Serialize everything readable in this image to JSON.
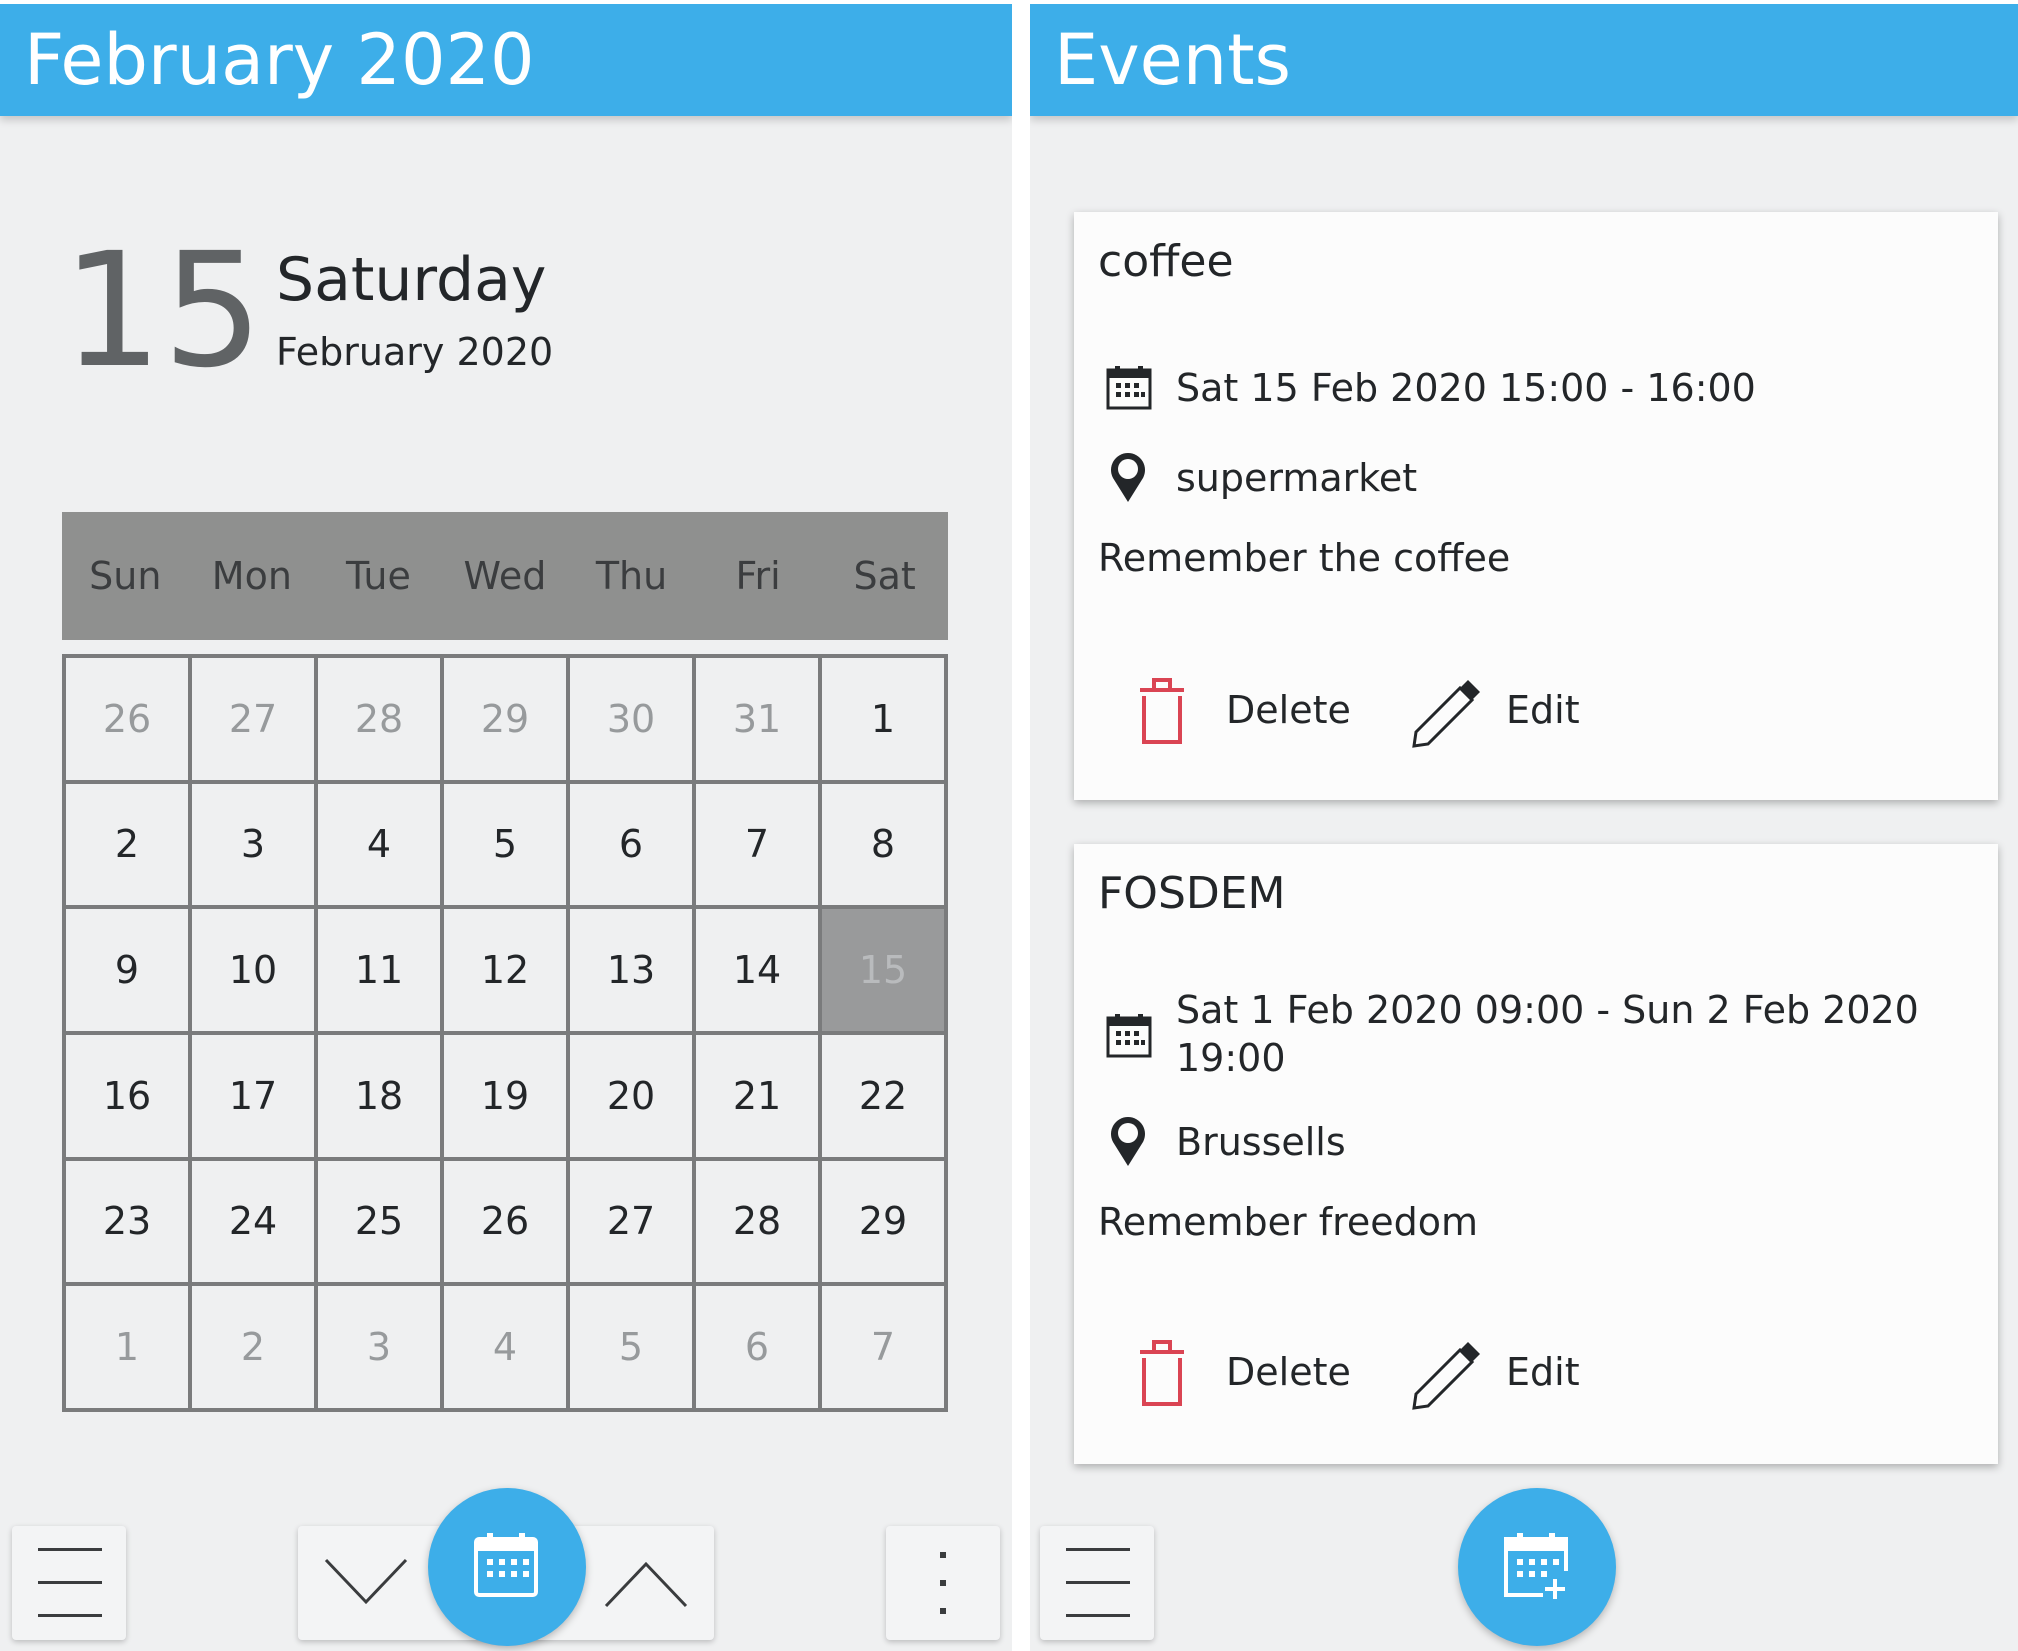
{
  "calendar_panel": {
    "title": "February 2020",
    "day_number": "15",
    "day_name": "Saturday",
    "day_month": "February 2020",
    "weekdays": [
      "Sun",
      "Mon",
      "Tue",
      "Wed",
      "Thu",
      "Fri",
      "Sat"
    ],
    "days": [
      {
        "label": "26",
        "in_month": false
      },
      {
        "label": "27",
        "in_month": false
      },
      {
        "label": "28",
        "in_month": false
      },
      {
        "label": "29",
        "in_month": false
      },
      {
        "label": "30",
        "in_month": false
      },
      {
        "label": "31",
        "in_month": false
      },
      {
        "label": "1",
        "in_month": true
      },
      {
        "label": "2",
        "in_month": true
      },
      {
        "label": "3",
        "in_month": true
      },
      {
        "label": "4",
        "in_month": true
      },
      {
        "label": "5",
        "in_month": true
      },
      {
        "label": "6",
        "in_month": true
      },
      {
        "label": "7",
        "in_month": true
      },
      {
        "label": "8",
        "in_month": true
      },
      {
        "label": "9",
        "in_month": true
      },
      {
        "label": "10",
        "in_month": true
      },
      {
        "label": "11",
        "in_month": true
      },
      {
        "label": "12",
        "in_month": true
      },
      {
        "label": "13",
        "in_month": true
      },
      {
        "label": "14",
        "in_month": true
      },
      {
        "label": "15",
        "in_month": true,
        "selected": true
      },
      {
        "label": "16",
        "in_month": true
      },
      {
        "label": "17",
        "in_month": true
      },
      {
        "label": "18",
        "in_month": true
      },
      {
        "label": "19",
        "in_month": true
      },
      {
        "label": "20",
        "in_month": true
      },
      {
        "label": "21",
        "in_month": true
      },
      {
        "label": "22",
        "in_month": true
      },
      {
        "label": "23",
        "in_month": true
      },
      {
        "label": "24",
        "in_month": true
      },
      {
        "label": "25",
        "in_month": true
      },
      {
        "label": "26",
        "in_month": true
      },
      {
        "label": "27",
        "in_month": true
      },
      {
        "label": "28",
        "in_month": true
      },
      {
        "label": "29",
        "in_month": true
      },
      {
        "label": "1",
        "in_month": false
      },
      {
        "label": "2",
        "in_month": false
      },
      {
        "label": "3",
        "in_month": false
      },
      {
        "label": "4",
        "in_month": false
      },
      {
        "label": "5",
        "in_month": false
      },
      {
        "label": "6",
        "in_month": false
      },
      {
        "label": "7",
        "in_month": false
      }
    ],
    "toolbar": {
      "menu_icon": "hamburger-icon",
      "prev_icon": "chevron-down-icon",
      "today_icon": "calendar-icon",
      "next_icon": "chevron-up-icon",
      "more_icon": "kebab-icon"
    }
  },
  "events_panel": {
    "title": "Events",
    "events": [
      {
        "title": "coffee",
        "when": "Sat 15 Feb 2020 15:00 - 16:00",
        "where": "supermarket",
        "description": "Remember the coffee",
        "delete_label": "Delete",
        "edit_label": "Edit"
      },
      {
        "title": "FOSDEM",
        "when_line1": "Sat 1 Feb 2020 09:00 - Sun 2 Feb 2020",
        "when_line2": "19:00",
        "where": "Brussells",
        "description": "Remember freedom",
        "delete_label": "Delete",
        "edit_label": "Edit"
      }
    ],
    "toolbar": {
      "menu_icon": "hamburger-icon",
      "add_icon": "calendar-add-icon"
    }
  },
  "colors": {
    "accent": "#3daee9",
    "background": "#eff0f1",
    "delete": "#da4453",
    "grid_header": "#8f908f"
  }
}
